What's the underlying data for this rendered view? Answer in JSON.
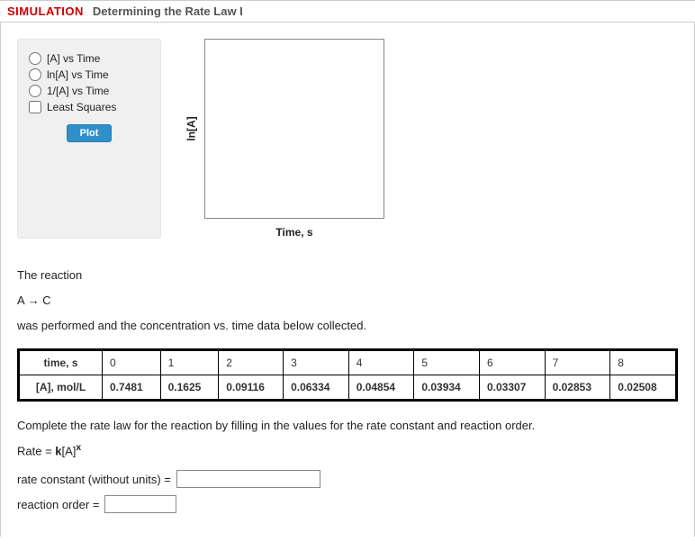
{
  "header": {
    "tag": "SIMULATION",
    "title": "Determining the Rate Law I"
  },
  "panel": {
    "options": [
      "[A] vs Time",
      "ln[A] vs Time",
      "1/[A] vs Time"
    ],
    "leastSquares": "Least Squares",
    "plot": "Plot"
  },
  "chart": {
    "ylabel": "ln[A]",
    "xlabel": "Time, s"
  },
  "text": {
    "intro1": "The reaction",
    "reaction": "A → C",
    "intro2": "was performed and the concentration vs. time data below collected.",
    "completeLaw": "Complete the rate law for the reaction by filling in the values for the rate constant and reaction order.",
    "rateEqLeft": "Rate = ",
    "rateEqK": "k",
    "rateEqA": "[A]",
    "rateEqX": "x",
    "rateConst": "rate constant (without units) =",
    "reactionOrder": "reaction order ="
  },
  "table": {
    "timeHeader": "time, s",
    "concHeader": "[A], mol/L",
    "times": [
      "0",
      "1",
      "2",
      "3",
      "4",
      "5",
      "6",
      "7",
      "8"
    ],
    "concs": [
      "0.7481",
      "0.1625",
      "0.09116",
      "0.06334",
      "0.04854",
      "0.03934",
      "0.03307",
      "0.02853",
      "0.02508"
    ]
  },
  "chart_data": {
    "type": "line",
    "title": "",
    "xlabel": "Time, s",
    "ylabel": "ln[A]",
    "x": [],
    "values": []
  }
}
